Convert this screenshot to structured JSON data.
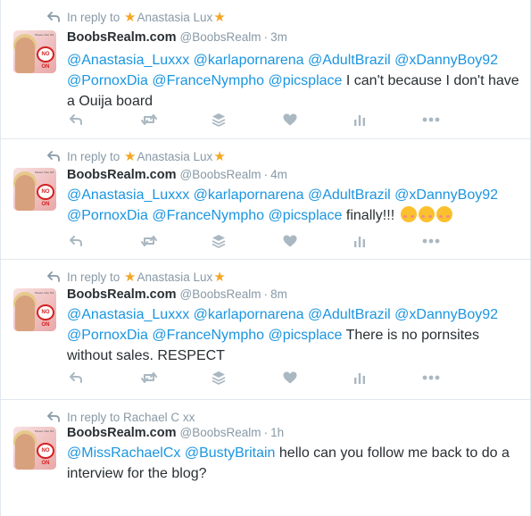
{
  "tweets": [
    {
      "reply_prefix": "In reply to",
      "reply_name": "Anastasia Lux",
      "reply_star_before": "★",
      "reply_star_after": "★",
      "display_name": "BoobsRealm.com",
      "handle": "@BoobsRealm",
      "separator": "·",
      "time": "3m",
      "mentions_line1": [
        "@Anastasia_Luxxx",
        "@karlapornarena",
        "@AdultBrazil",
        "@xDannyBoy92"
      ],
      "mentions_line2": [
        "@PornoxDia",
        "@FranceNympho",
        "@picsplace"
      ],
      "text": "I can't because I don't have a Ouija board",
      "emoji_count": 0
    },
    {
      "reply_prefix": "In reply to",
      "reply_name": "Anastasia Lux",
      "reply_star_before": "★",
      "reply_star_after": "★",
      "display_name": "BoobsRealm.com",
      "handle": "@BoobsRealm",
      "separator": "·",
      "time": "4m",
      "mentions_line1": [
        "@Anastasia_Luxxx",
        "@karlapornarena",
        "@AdultBrazil",
        "@xDannyBoy92"
      ],
      "mentions_line2": [
        "@PornoxDia",
        "@FranceNympho",
        "@picsplace"
      ],
      "text": "finally!!!",
      "emoji_count": 3,
      "emoji_name": "smiling-face-with-blush-icon"
    },
    {
      "reply_prefix": "In reply to",
      "reply_name": "Anastasia Lux",
      "reply_star_before": "★",
      "reply_star_after": "★",
      "display_name": "BoobsRealm.com",
      "handle": "@BoobsRealm",
      "separator": "·",
      "time": "8m",
      "mentions_line1": [
        "@Anastasia_Luxxx",
        "@karlapornarena",
        "@AdultBrazil",
        "@xDannyBoy92"
      ],
      "mentions_line2": [
        "@PornoxDia",
        "@FranceNympho",
        "@picsplace"
      ],
      "text": "There is no pornsites without sales. RESPECT",
      "emoji_count": 0
    },
    {
      "reply_prefix": "In reply to",
      "reply_name": "Rachael C xx",
      "display_name": "BoobsRealm.com",
      "handle": "@BoobsRealm",
      "separator": "·",
      "time": "1h",
      "mentions_line1": [
        "@MissRachaelCx",
        "@BustyBritain"
      ],
      "text": "hello can you follow me back to do a interview for the blog?",
      "emoji_count": 0
    }
  ],
  "avatar": {
    "sign_text": "NO ON 60",
    "caption": "Please Vote NO"
  },
  "actions": [
    "reply-icon",
    "retweet-icon",
    "stack-icon",
    "like-icon",
    "analytics-icon",
    "more-icon"
  ],
  "colors": {
    "link": "#1b95e0",
    "meta": "#8899a6",
    "text": "#292f33",
    "star": "#f5a623",
    "divider": "#e1e8ed",
    "icon": "#aab8c2"
  }
}
